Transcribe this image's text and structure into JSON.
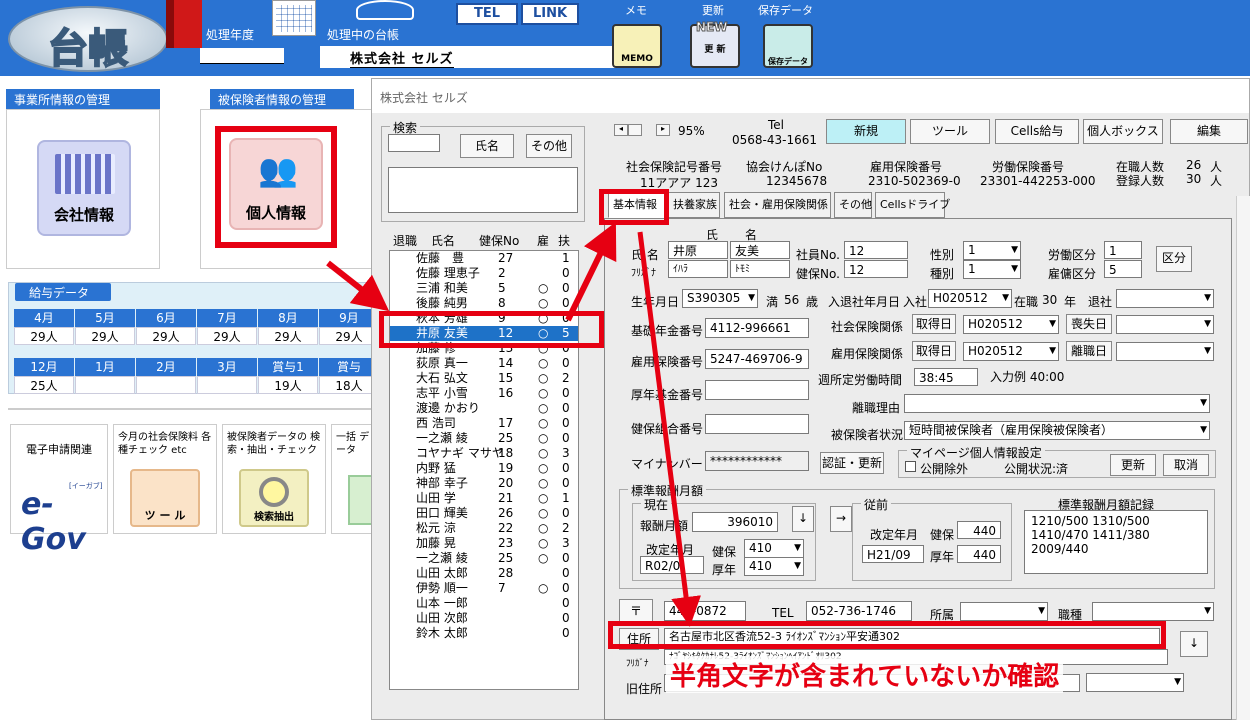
{
  "header": {
    "logo": "台帳",
    "fiscal_year_label": "処理年度",
    "current_ledger_label": "処理中の台帳",
    "company_name": "株式会社 セルズ",
    "tel_btn": "TEL",
    "link_btn": "LINK",
    "memo_cap": "メモ",
    "update_cap": "更新",
    "saved_cap": "保存データ",
    "memo_icon": "MEMO",
    "new_badge": "NEW",
    "update_icon": "更 新",
    "saved_icon": "保存データ"
  },
  "left": {
    "office_head": "事業所情報の管理",
    "office_tile": "会社情報",
    "insured_head": "被保険者情報の管理",
    "insured_tile": "個人情報",
    "salary_head": "給与データ",
    "months1": [
      "4月",
      "5月",
      "6月",
      "7月",
      "8月",
      "9月"
    ],
    "counts1": [
      "29人",
      "29人",
      "29人",
      "29人",
      "29人",
      "29人"
    ],
    "months2": [
      "12月",
      "1月",
      "2月",
      "3月",
      "賞与1",
      "賞与"
    ],
    "counts2": [
      "25人",
      "",
      "",
      "",
      "19人",
      "18人"
    ],
    "bottom": {
      "egov_title": "電子申請関連",
      "egov_logo": "e-Gov",
      "egov_small": "[イーガブ]",
      "check_title": "今月の社会保険料 各種チェック etc",
      "check_tile": "ツ ー ル",
      "search_title": "被保険者データの 検索・抽出・チェック",
      "search_tile": "検索抽出",
      "batch_title": "一括 データ"
    }
  },
  "window": {
    "title": "株式会社 セルズ",
    "search_group": "検索",
    "name_btn": "氏名",
    "other_btn": "その他",
    "zoom": "95%",
    "tel_label": "Tel",
    "tel_value": "0568-43-1661",
    "toolbar": [
      "新規",
      "ツール",
      "Cells給与",
      "個人ボックス",
      "編集"
    ],
    "codes": {
      "h1": "社会保険記号番号",
      "v1": "11アアア 123",
      "h2": "協会けんぽNo",
      "v2": "12345678",
      "h3": "雇用保険番号",
      "v3": "2310-502369-0",
      "h4": "労働保険番号",
      "v4": "23301-442253-000",
      "enrolled_label": "在職人数",
      "enrolled": "26",
      "enrolled_unit": "人",
      "registered_label": "登録人数",
      "registered": "30",
      "registered_unit": "人"
    },
    "list_headers": [
      "退職",
      "氏名",
      "健保No",
      "雇",
      "扶"
    ],
    "list": [
      [
        "佐藤　豊",
        "27",
        "",
        "1"
      ],
      [
        "佐藤 理恵子",
        "2",
        "",
        "0"
      ],
      [
        "三浦 和美",
        "5",
        "○",
        "0"
      ],
      [
        "後藤 純男",
        "8",
        "○",
        "0"
      ],
      [
        "秋本 芳雄",
        "9",
        "○",
        "0"
      ],
      [
        "井原 友美",
        "12",
        "○",
        "5"
      ],
      [
        "加藤 修",
        "13",
        "○",
        "0"
      ],
      [
        "荻原 真一",
        "14",
        "○",
        "0"
      ],
      [
        "大石 弘文",
        "15",
        "○",
        "2"
      ],
      [
        "志平 小雪",
        "16",
        "○",
        "0"
      ],
      [
        "渡邊 かおり",
        "",
        "○",
        "0"
      ],
      [
        "西 浩司",
        "17",
        "○",
        "0"
      ],
      [
        "一之瀬 綾",
        "25",
        "○",
        "0"
      ],
      [
        "コヤナギ マサヤ",
        "18",
        "○",
        "3"
      ],
      [
        "内野 猛",
        "19",
        "○",
        "0"
      ],
      [
        "神部 幸子",
        "20",
        "○",
        "0"
      ],
      [
        "山田 学",
        "21",
        "○",
        "1"
      ],
      [
        "田口 輝美",
        "26",
        "○",
        "0"
      ],
      [
        "松元 涼",
        "22",
        "○",
        "2"
      ],
      [
        "加藤 晃",
        "23",
        "○",
        "3"
      ],
      [
        "一之瀬 綾",
        "25",
        "○",
        "0"
      ],
      [
        "山田 太郎",
        "28",
        "",
        "0"
      ],
      [
        "伊勢 順一",
        "7",
        "○",
        "0"
      ],
      [
        "山本 一郎",
        "",
        "",
        "0"
      ],
      [
        "山田 次郎",
        "",
        "",
        "0"
      ],
      [
        "鈴木 太郎",
        "",
        "",
        "0"
      ]
    ],
    "tabs": [
      "基本情報",
      "扶養家族",
      "社会・雇用保険関係",
      "その他",
      "Cellsドライブ"
    ],
    "form": {
      "name_label": "氏 名",
      "kana_label": "ﾌﾘｶﾞﾅ",
      "sei": "氏",
      "mei": "名",
      "last": "井原",
      "first": "友美",
      "last_kana": "ｲﾊﾗ",
      "first_kana": "ﾄﾓﾐ",
      "emp_no_label": "社員No.",
      "emp_no": "12",
      "kenpo_label": "健保No.",
      "kenpo": "12",
      "sex_label": "性別",
      "sex": "1",
      "type_label": "種別",
      "type": "1",
      "labor_label": "労働区分",
      "labor": "1",
      "emp_class_label": "雇傭区分",
      "emp_class": "5",
      "kubun_btn": "区分",
      "birth_label": "生年月日",
      "birth": "S390305",
      "age_label": "満",
      "age": "56",
      "age_unit": "歳",
      "join_label": "入退社年月日",
      "join_sub": "入社",
      "join": "H020512",
      "tenure_label": "在職",
      "tenure": "30",
      "tenure_unit": "年",
      "leave_label": "退社",
      "pension_label": "基礎年金番号",
      "pension": "4112-996661",
      "social_label": "社会保険関係",
      "acquire_btn": "取得日",
      "social_date": "H020512",
      "lose_btn": "喪失日",
      "emp_ins_label": "雇用保険番号",
      "emp_ins": "5247-469706-9",
      "emp_rel_label": "雇用保険関係",
      "emp_acquire_btn": "取得日",
      "emp_date": "H020512",
      "leave_btn": "離職日",
      "welfare_label": "厚年基金番号",
      "weekly_label": "週所定労働時間",
      "weekly": "38:45",
      "weekly_example": "入力例 40:00",
      "reason_label": "離職理由",
      "union_label": "健保組合番号",
      "status_label": "被保険者状況",
      "status": "短時間被保険者（雇用保険被保険者）",
      "mynumber_label": "マイナンバー",
      "mynumber": "************",
      "auth_btn": "認証・更新",
      "mypage_group": "マイページ個人情報設定",
      "exclude_label": "公開除外",
      "public_status": "公開状況:済",
      "update_btn": "更新",
      "cancel_btn": "取消",
      "std_group": "標準報酬月額",
      "now_group": "現在",
      "prev_group": "従前",
      "monthly_label": "報酬月額",
      "monthly": "396010",
      "down_btn": "↓",
      "right_btn": "→",
      "revised_label": "改定年月",
      "revised": "R02/0",
      "kenpo_s": "健保",
      "kenpo_val": "410",
      "kounen_s": "厚年",
      "kounen_val": "410",
      "prev_revised_label": "改定年月",
      "prev_revised": "H21/09",
      "prev_kenpo_label": "健保",
      "prev_kenpo": "440",
      "prev_kounen_label": "厚年",
      "prev_kounen": "440",
      "record_label": "標準報酬月額記録",
      "record_lines": [
        "1210/500 1310/500",
        "1410/470 1411/380",
        "2009/440"
      ],
      "zip_btn": "〒",
      "zip": "445-0872",
      "tel_label": "TEL",
      "tel": "052-736-1746",
      "dept_label": "所属",
      "job_label": "職種",
      "address_btn": "住所",
      "address": "名古屋市北区香流52-3 ﾗｲｵﾝｽﾞﾏﾝｼｮﾝ平安通302",
      "addr_kana_label": "ﾌﾘｶﾞﾅ",
      "addr_kana": "ﾅｺﾞﾔｼｷﾀｸｶﾅﾚ52-3ﾗｲｵﾝｽﾞﾏﾝｼｮﾝﾍｲｱﾝﾄﾞｵﾘ302",
      "addr_down": "↓",
      "old_addr_label": "旧住所"
    },
    "annotation": "半角文字が含まれていないか確認"
  }
}
